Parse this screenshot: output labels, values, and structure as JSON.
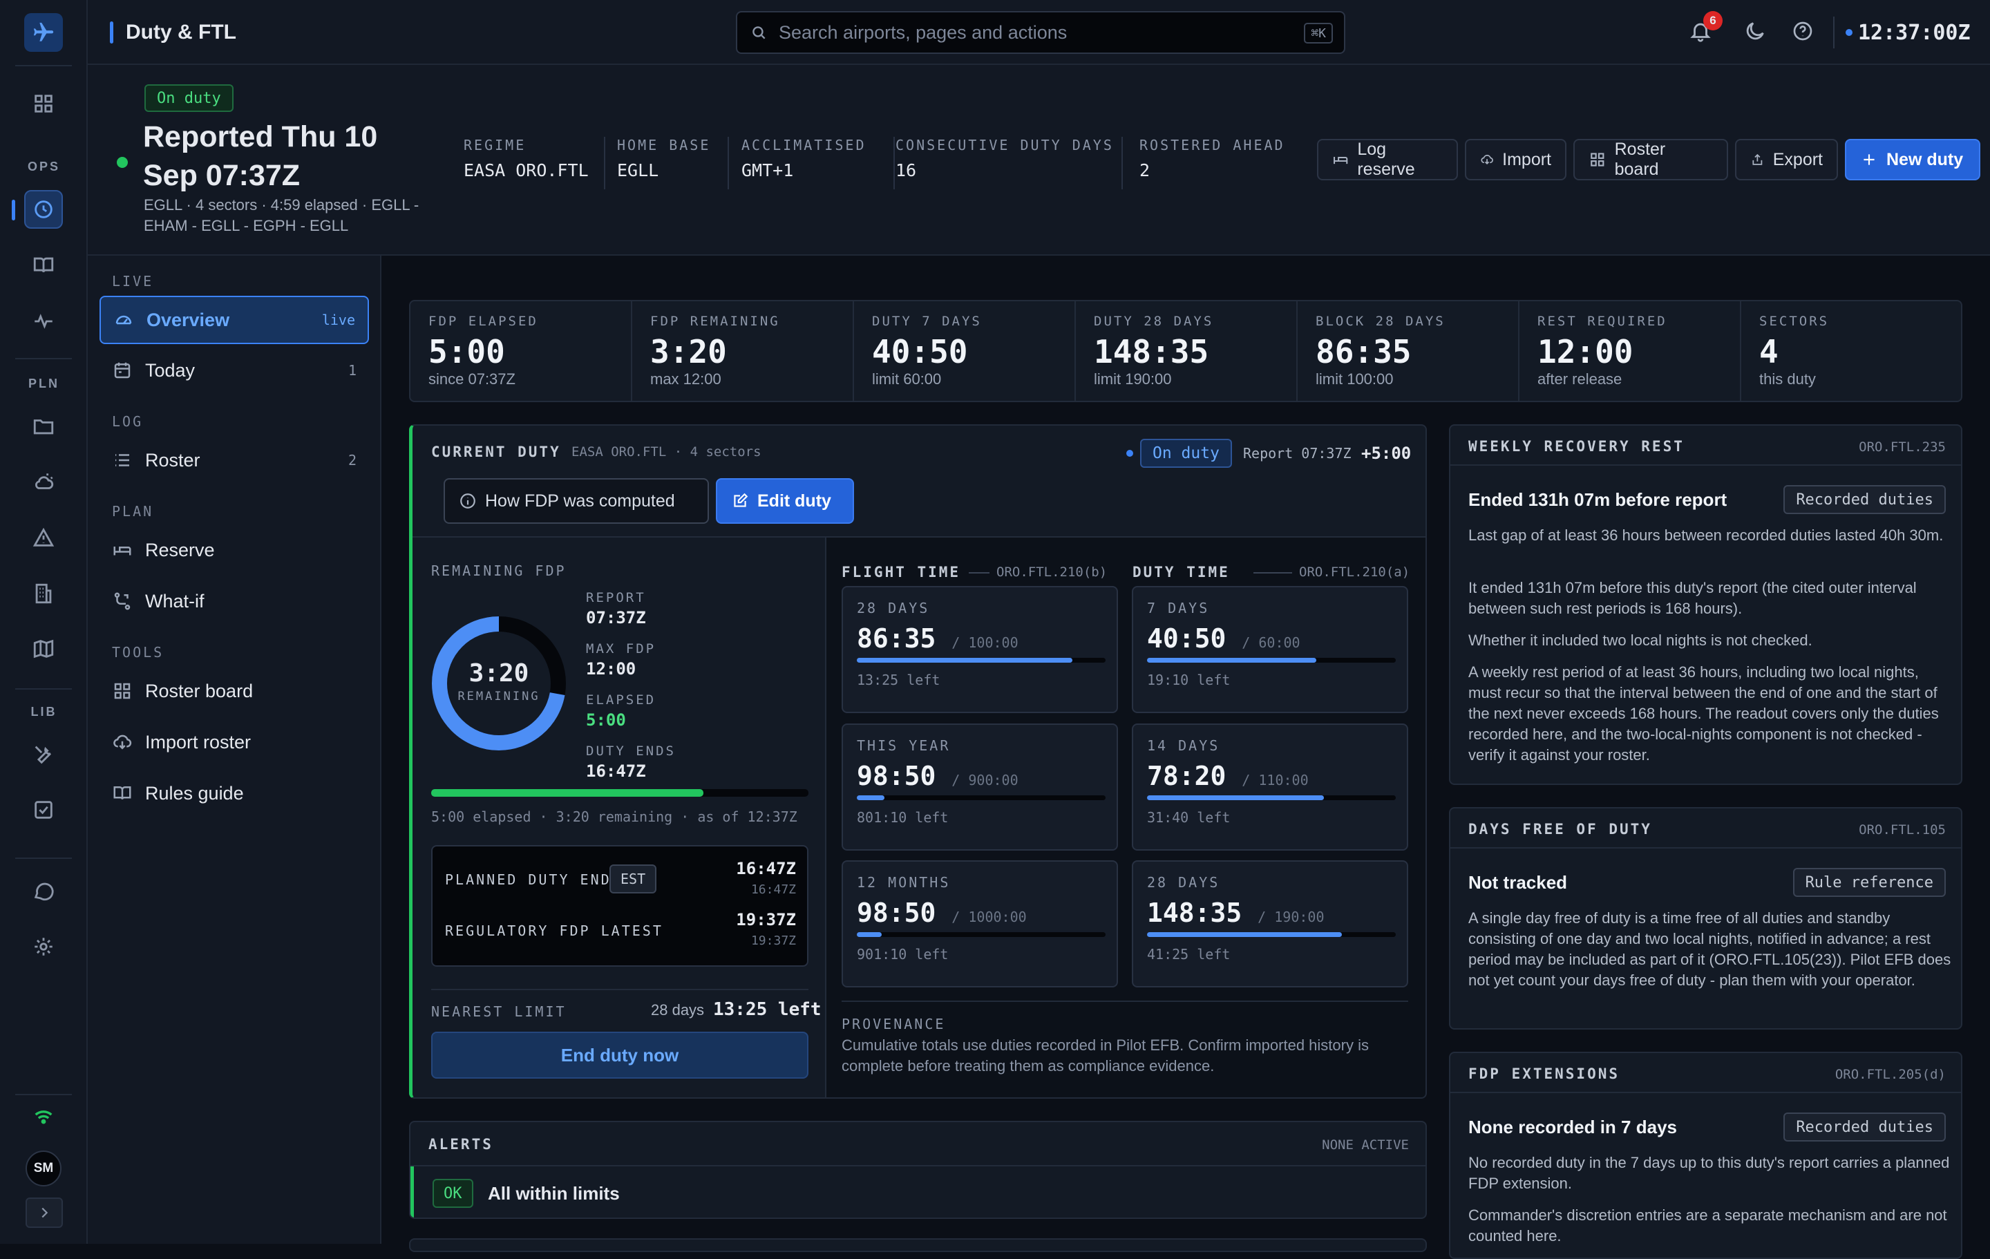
{
  "app": {
    "title": "Duty & FTL",
    "clock": "12:37:00Z",
    "notif_count": "6",
    "user_initials": "SM"
  },
  "search": {
    "placeholder": "Search airports, pages and actions",
    "shortcut": "⌘K"
  },
  "rail": {
    "sections": [
      "OPS",
      "PLN",
      "LIB"
    ]
  },
  "duty_header": {
    "status": "On duty",
    "title_line1": "Reported Thu 10",
    "title_line2": "Sep 07:37Z",
    "sub_line1": "EGLL · 4 sectors · 4:59 elapsed · EGLL -",
    "sub_line2": "EHAM - EGLL - EGPH - EGLL",
    "meta": [
      {
        "label": "REGIME",
        "value": "EASA ORO.FTL"
      },
      {
        "label": "HOME BASE",
        "value": "EGLL"
      },
      {
        "label": "ACCLIMATISED",
        "value": "GMT+1"
      },
      {
        "label": "CONSECUTIVE DUTY DAYS",
        "value": "16"
      },
      {
        "label": "ROSTERED AHEAD",
        "value": "2"
      }
    ],
    "actions": {
      "log_reserve": "Log reserve",
      "import": "Import",
      "roster_board": "Roster board",
      "export": "Export",
      "new_duty": "New duty"
    }
  },
  "sidebar": {
    "sections": {
      "live": "LIVE",
      "log": "LOG",
      "plan": "PLAN",
      "tools": "TOOLS"
    },
    "items": [
      {
        "label": "Overview",
        "badge": "live"
      },
      {
        "label": "Today",
        "count": "1"
      },
      {
        "label": "Roster",
        "count": "2"
      },
      {
        "label": "Reserve"
      },
      {
        "label": "What-if"
      },
      {
        "label": "Roster board"
      },
      {
        "label": "Import roster"
      },
      {
        "label": "Rules guide"
      }
    ]
  },
  "stats": [
    {
      "label": "FDP ELAPSED",
      "value": "5:00",
      "sub": "since 07:37Z"
    },
    {
      "label": "FDP REMAINING",
      "value": "3:20",
      "sub": "max 12:00"
    },
    {
      "label": "DUTY 7 DAYS",
      "value": "40:50",
      "sub": "limit 60:00"
    },
    {
      "label": "DUTY 28 DAYS",
      "value": "148:35",
      "sub": "limit 190:00"
    },
    {
      "label": "BLOCK 28 DAYS",
      "value": "86:35",
      "sub": "limit 100:00"
    },
    {
      "label": "REST REQUIRED",
      "value": "12:00",
      "sub": "after release"
    },
    {
      "label": "SECTORS",
      "value": "4",
      "sub": "this duty"
    }
  ],
  "current_duty": {
    "title": "CURRENT DUTY",
    "meta": "EASA ORO.FTL · 4 sectors",
    "status": "On duty",
    "report": "Report 07:37Z",
    "offset": "+5:00",
    "how_btn": "How FDP was computed",
    "edit_btn": "Edit duty",
    "remaining_label": "REMAINING FDP",
    "ring_value": "3:20",
    "ring_label": "REMAINING",
    "ring_fraction": 0.278,
    "facts": [
      {
        "label": "REPORT",
        "value": "07:37Z"
      },
      {
        "label": "MAX FDP",
        "value": "12:00"
      },
      {
        "label": "ELAPSED",
        "value": "5:00"
      },
      {
        "label": "DUTY ENDS",
        "value": "16:47Z"
      }
    ],
    "progress_fraction": 0.722,
    "progress_caption": "5:00 elapsed · 3:20 remaining · as of 12:37Z",
    "planned_end_label": "PLANNED DUTY END",
    "planned_end_tag": "EST",
    "planned_end_value": "16:47Z",
    "planned_end_sub": "16:47Z",
    "reg_latest_label": "REGULATORY FDP LATEST",
    "reg_latest_value": "19:37Z",
    "reg_latest_sub": "19:37Z",
    "nearest_label": "NEAREST LIMIT",
    "nearest_period": "28 days",
    "nearest_value": "13:25 left",
    "end_btn": "End duty now",
    "flight_time": {
      "title": "FLIGHT TIME",
      "ref": "ORO.FTL.210(b)"
    },
    "duty_time": {
      "title": "DUTY TIME",
      "ref": "ORO.FTL.210(a)"
    },
    "flight_cards": [
      {
        "label": "28 DAYS",
        "value": "86:35",
        "limit": "/ 100:00",
        "left": "13:25 left",
        "fraction": 0.866
      },
      {
        "label": "THIS YEAR",
        "value": "98:50",
        "limit": "/ 900:00",
        "left": "801:10 left",
        "fraction": 0.11
      },
      {
        "label": "12 MONTHS",
        "value": "98:50",
        "limit": "/ 1000:00",
        "left": "901:10 left",
        "fraction": 0.099
      }
    ],
    "duty_cards": [
      {
        "label": "7 DAYS",
        "value": "40:50",
        "limit": "/ 60:00",
        "left": "19:10 left",
        "fraction": 0.681
      },
      {
        "label": "14 DAYS",
        "value": "78:20",
        "limit": "/ 110:00",
        "left": "31:40 left",
        "fraction": 0.712
      },
      {
        "label": "28 DAYS",
        "value": "148:35",
        "limit": "/ 190:00",
        "left": "41:25 left",
        "fraction": 0.782
      }
    ],
    "provenance_label": "PROVENANCE",
    "provenance_line1": "Cumulative totals use duties recorded in Pilot EFB. Confirm imported history is",
    "provenance_line2": "complete before treating them as compliance evidence."
  },
  "alerts": {
    "title": "ALERTS",
    "status": "NONE ACTIVE",
    "badge": "OK",
    "text": "All within limits"
  },
  "weekly_rest": {
    "title": "WEEKLY RECOVERY REST",
    "ref": "ORO.FTL.235",
    "heading": "Ended 131h 07m before report",
    "pill": "Recorded duties",
    "p1": "Last gap of at least 36 hours between recorded duties lasted 40h 30m.",
    "p2": "It ended 131h 07m before this duty's report (the cited outer interval between such rest periods is 168 hours).",
    "p3": "Whether it included two local nights is not checked.",
    "p4": "A weekly rest period of at least 36 hours, including two local nights, must recur so that the interval between the end of one and the start of the next never exceeds 168 hours. The readout covers only the duties recorded here, and the two-local-nights component is not checked - verify it against your roster."
  },
  "days_free": {
    "title": "DAYS FREE OF DUTY",
    "ref": "ORO.FTL.105",
    "heading": "Not tracked",
    "pill": "Rule reference",
    "p1": "A single day free of duty is a time free of all duties and standby consisting of one day and two local nights, notified in advance; a rest period may be included as part of it (ORO.FTL.105(23)). Pilot EFB does not yet count your days free of duty - plan them with your operator."
  },
  "fdp_ext": {
    "title": "FDP EXTENSIONS",
    "ref": "ORO.FTL.205(d)",
    "heading": "None recorded in 7 days",
    "pill": "Recorded duties",
    "p1": "No recorded duty in the 7 days up to this duty's report carries a planned FDP extension.",
    "p2": "Commander's discretion entries are a separate mechanism and are not counted here."
  }
}
